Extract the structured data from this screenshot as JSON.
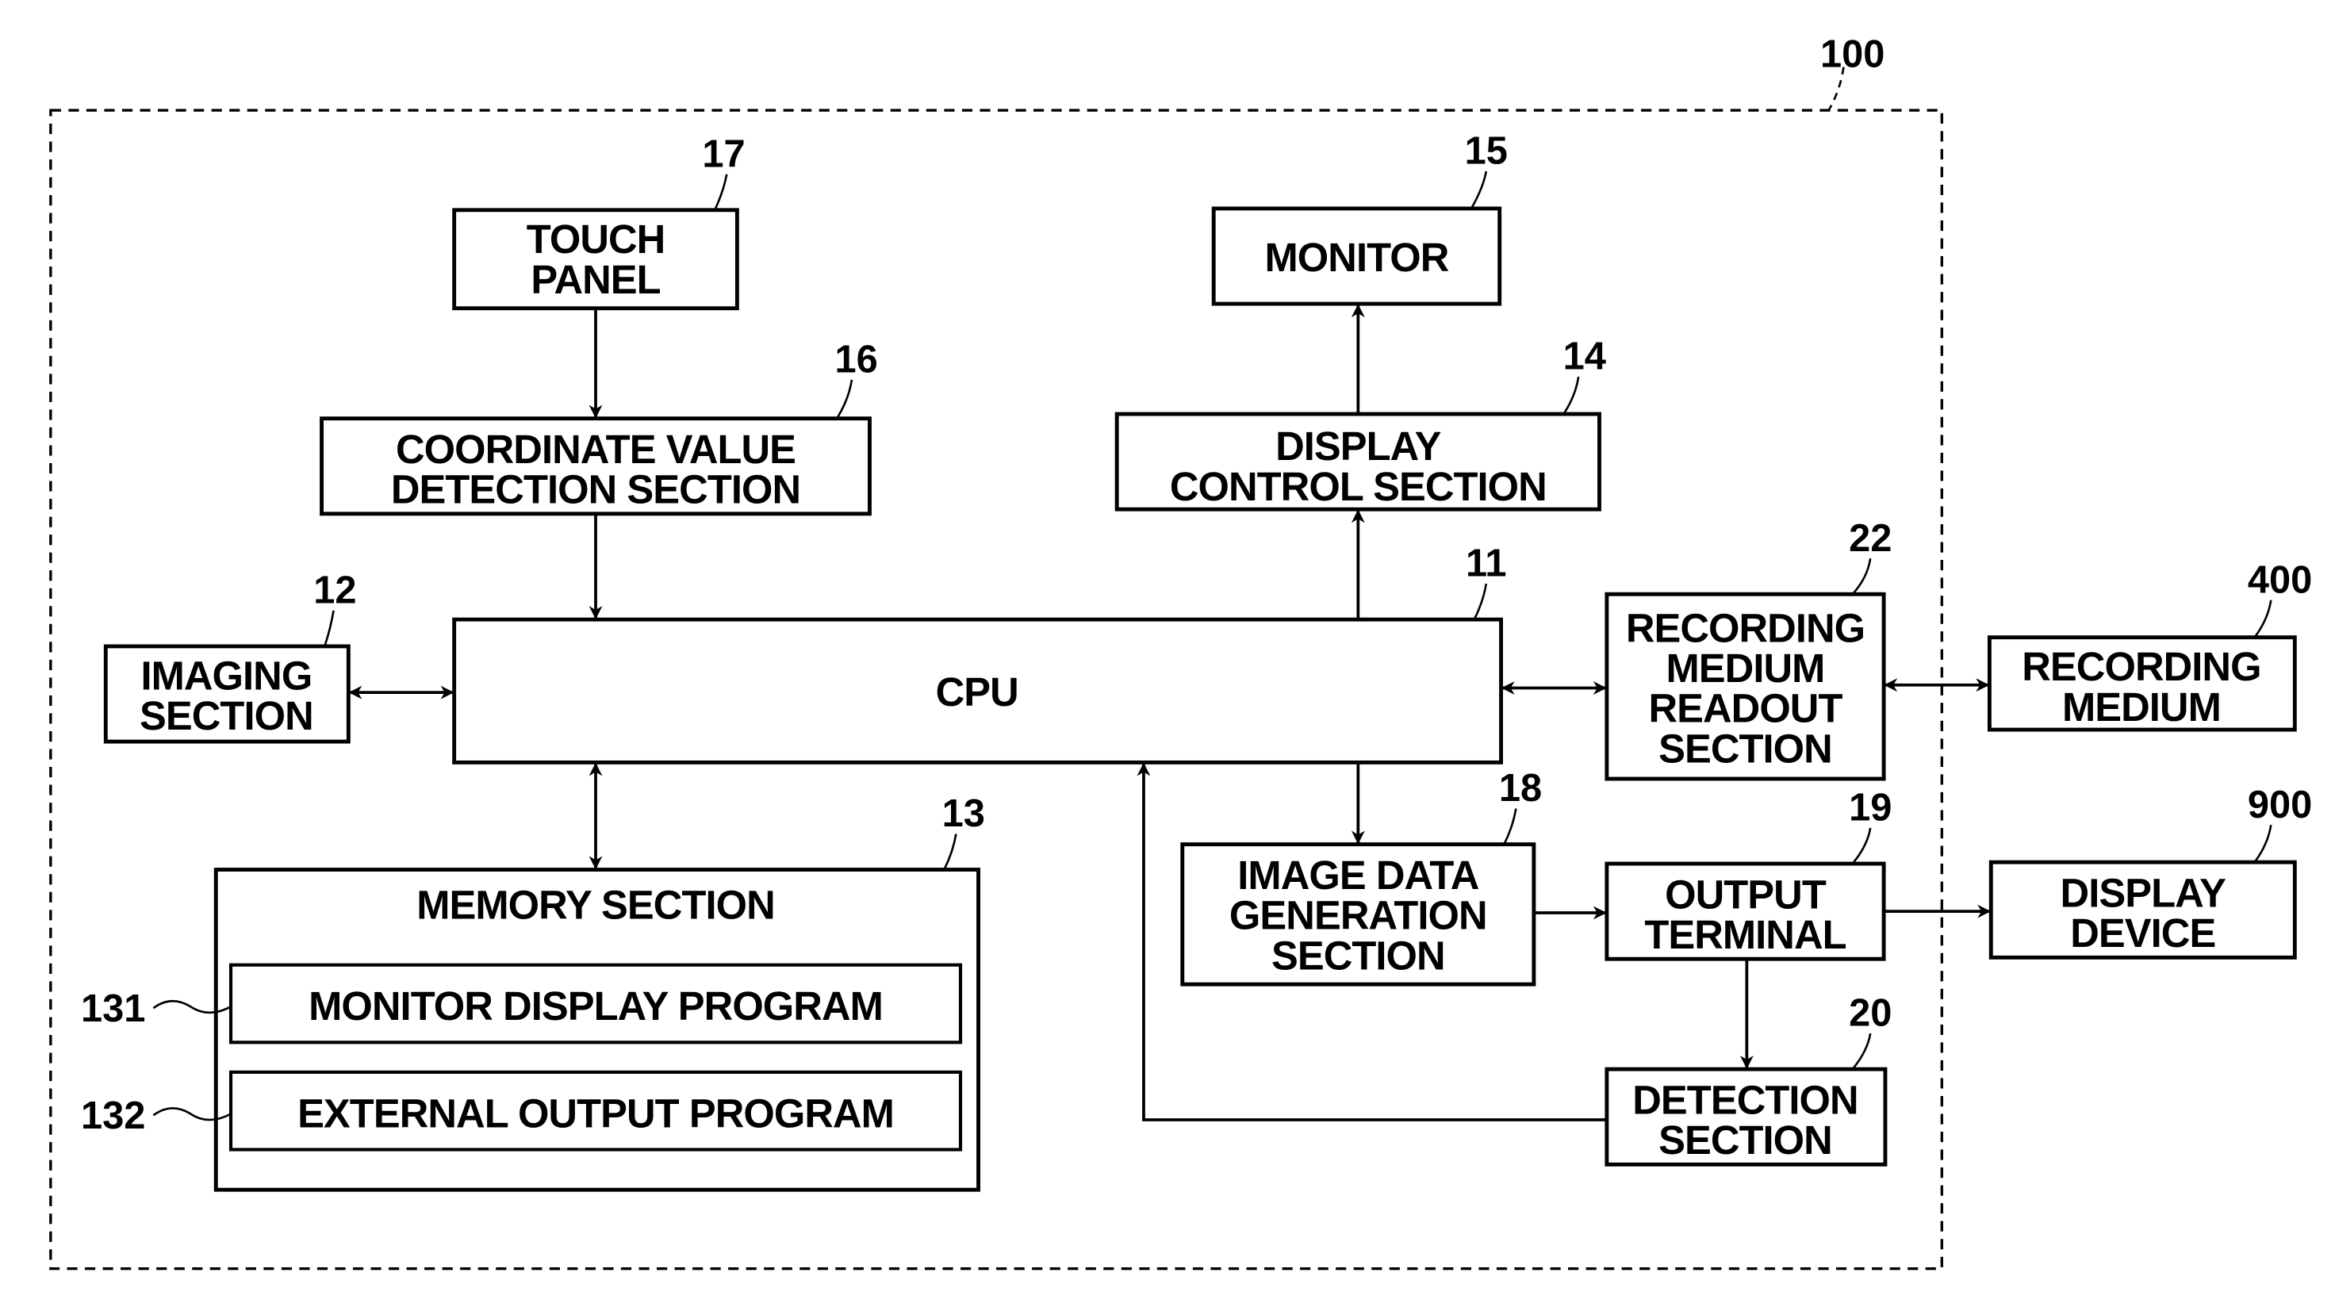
{
  "diagram": {
    "system_ref": "100",
    "blocks": {
      "touch_panel": {
        "ref": "17",
        "lines": [
          "TOUCH",
          "PANEL"
        ]
      },
      "coordinate": {
        "ref": "16",
        "lines": [
          "COORDINATE VALUE",
          "DETECTION SECTION"
        ]
      },
      "monitor": {
        "ref": "15",
        "lines": [
          "MONITOR"
        ]
      },
      "display_control": {
        "ref": "14",
        "lines": [
          "DISPLAY",
          "CONTROL SECTION"
        ]
      },
      "imaging": {
        "ref": "12",
        "lines": [
          "IMAGING",
          "SECTION"
        ]
      },
      "cpu": {
        "ref": "11",
        "lines": [
          "CPU"
        ]
      },
      "readout": {
        "ref": "22",
        "lines": [
          "RECORDING",
          "MEDIUM",
          "READOUT",
          "SECTION"
        ]
      },
      "recording_medium": {
        "ref": "400",
        "lines": [
          "RECORDING",
          "MEDIUM"
        ]
      },
      "memory": {
        "ref": "13",
        "lines": [
          "MEMORY SECTION"
        ]
      },
      "monitor_program": {
        "ref": "131",
        "lines": [
          "MONITOR DISPLAY PROGRAM"
        ]
      },
      "external_program": {
        "ref": "132",
        "lines": [
          "EXTERNAL OUTPUT PROGRAM"
        ]
      },
      "image_data": {
        "ref": "18",
        "lines": [
          "IMAGE DATA",
          "GENERATION",
          "SECTION"
        ]
      },
      "output_terminal": {
        "ref": "19",
        "lines": [
          "OUTPUT",
          "TERMINAL"
        ]
      },
      "display_device": {
        "ref": "900",
        "lines": [
          "DISPLAY",
          "DEVICE"
        ]
      },
      "detection": {
        "ref": "20",
        "lines": [
          "DETECTION",
          "SECTION"
        ]
      }
    },
    "connections": [
      {
        "from": "touch_panel",
        "to": "coordinate",
        "type": "arrow"
      },
      {
        "from": "coordinate",
        "to": "cpu",
        "type": "arrow"
      },
      {
        "from": "cpu",
        "to": "display_control",
        "type": "arrow"
      },
      {
        "from": "display_control",
        "to": "monitor",
        "type": "arrow"
      },
      {
        "from": "imaging",
        "to": "cpu",
        "type": "bidirectional"
      },
      {
        "from": "cpu",
        "to": "memory",
        "type": "bidirectional"
      },
      {
        "from": "cpu",
        "to": "readout",
        "type": "bidirectional"
      },
      {
        "from": "readout",
        "to": "recording_medium",
        "type": "bidirectional"
      },
      {
        "from": "cpu",
        "to": "image_data",
        "type": "arrow"
      },
      {
        "from": "image_data",
        "to": "output_terminal",
        "type": "arrow"
      },
      {
        "from": "output_terminal",
        "to": "display_device",
        "type": "arrow"
      },
      {
        "from": "output_terminal",
        "to": "detection",
        "type": "arrow"
      },
      {
        "from": "detection",
        "to": "cpu",
        "type": "arrow"
      }
    ]
  }
}
